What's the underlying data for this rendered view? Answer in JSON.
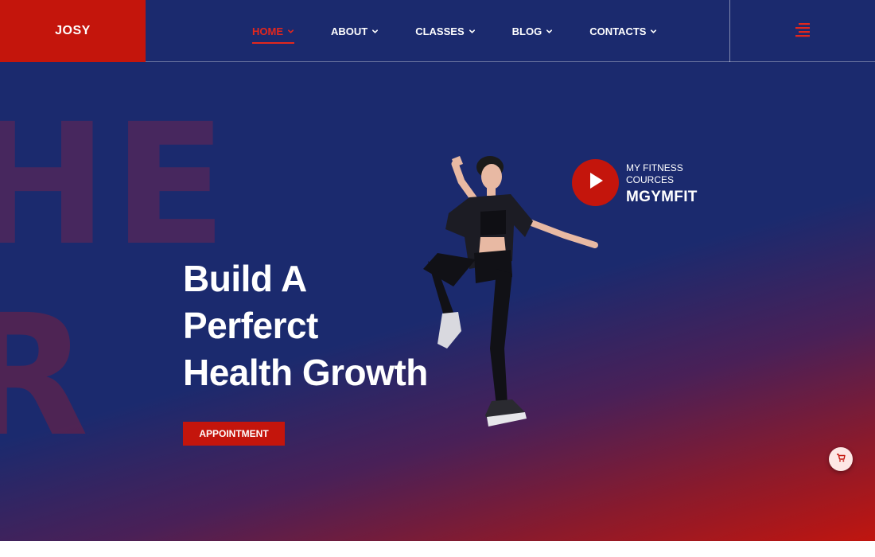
{
  "header": {
    "logo": "JOSY",
    "nav": [
      {
        "label": "HOME",
        "active": true
      },
      {
        "label": "ABOUT",
        "active": false
      },
      {
        "label": "CLASSES",
        "active": false
      },
      {
        "label": "BLOG",
        "active": false
      },
      {
        "label": "CONTACTS",
        "active": false
      }
    ],
    "menu_icon": "hamburger-icon"
  },
  "hero": {
    "bg_word_top": "HE",
    "bg_word_bottom": "R",
    "headline": [
      "Build A",
      "Perferct",
      "Health Growth"
    ],
    "cta_label": "APPOINTMENT",
    "promo": {
      "line1": "MY FITNESS",
      "line2": "COURCES",
      "brand": "MGYMFIT",
      "play_icon": "play-icon"
    }
  },
  "floating": {
    "cart_icon": "cart-icon"
  },
  "colors": {
    "navy": "#1b2a6e",
    "red": "#c4150c",
    "accent_red": "#e3271d",
    "white": "#ffffff"
  }
}
